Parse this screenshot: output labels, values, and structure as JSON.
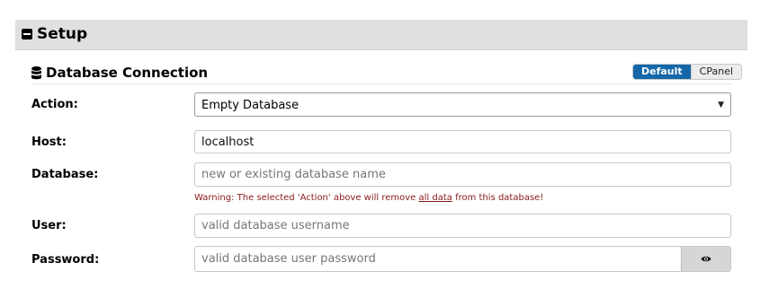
{
  "setup": {
    "title": "Setup"
  },
  "database_section": {
    "title": "Database Connection",
    "mode_toggle": {
      "options": [
        "Default",
        "CPanel"
      ],
      "active": "Default"
    }
  },
  "form": {
    "action": {
      "label": "Action:",
      "value": "Empty Database"
    },
    "host": {
      "label": "Host:",
      "value": "localhost"
    },
    "database": {
      "label": "Database:",
      "value": "",
      "placeholder": "new or existing database name"
    },
    "warning": {
      "before": "Warning: The selected 'Action' above will remove ",
      "link": "all data",
      "after": " from this database!"
    },
    "user": {
      "label": "User:",
      "value": "",
      "placeholder": "valid database username"
    },
    "password": {
      "label": "Password:",
      "value": "",
      "placeholder": "valid database user password"
    }
  },
  "colors": {
    "accent": "#1467a8",
    "warning": "#8b1a1a",
    "section_bar": "#e0e0e0"
  },
  "icons": {
    "setup": "minus-square-icon",
    "database": "database-icon",
    "select": "caret-down-icon",
    "password_toggle": "eye-icon"
  }
}
